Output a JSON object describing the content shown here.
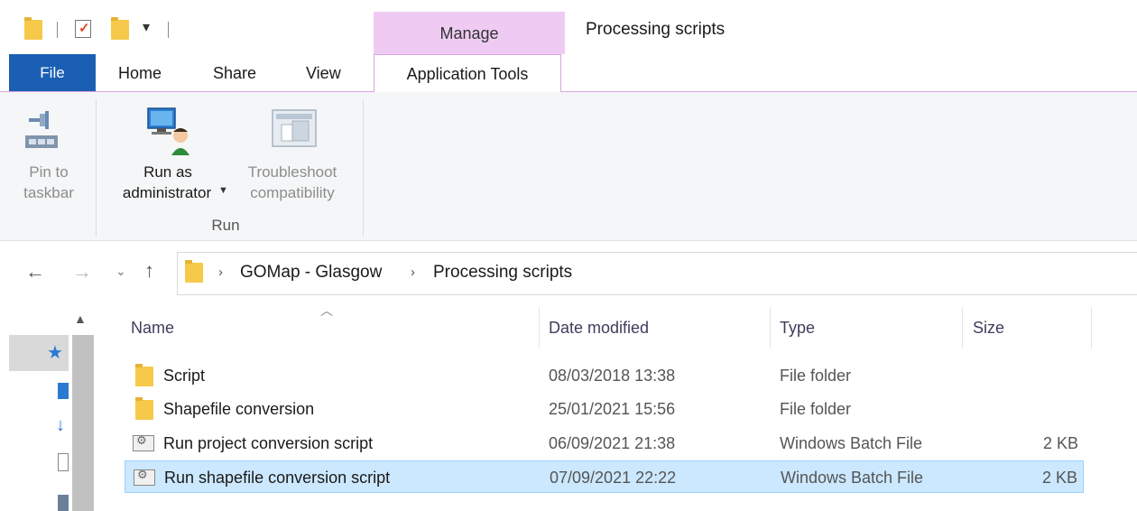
{
  "window": {
    "title": "Processing scripts"
  },
  "context_tab": {
    "label": "Manage"
  },
  "tabs": {
    "file": "File",
    "home": "Home",
    "share": "Share",
    "view": "View",
    "application_tools": "Application Tools"
  },
  "ribbon": {
    "pin": {
      "line1": "Pin to",
      "line2": "taskbar"
    },
    "run_admin": {
      "line1": "Run as",
      "line2": "administrator"
    },
    "troubleshoot": {
      "line1": "Troubleshoot",
      "line2": "compatibility"
    },
    "group_run": "Run"
  },
  "address": {
    "crumbs": [
      "GOMap - Glasgow",
      "Processing scripts"
    ]
  },
  "columns": {
    "name": "Name",
    "date": "Date modified",
    "type": "Type",
    "size": "Size"
  },
  "files": [
    {
      "name": "Script",
      "date": "08/03/2018 13:38",
      "type": "File folder",
      "size": "",
      "icon": "folder-icon"
    },
    {
      "name": "Shapefile conversion",
      "date": "25/01/2021 15:56",
      "type": "File folder",
      "size": "",
      "icon": "folder-icon"
    },
    {
      "name": "Run project conversion script",
      "date": "06/09/2021 21:38",
      "type": "Windows Batch File",
      "size": "2 KB",
      "icon": "batch-file-icon"
    },
    {
      "name": "Run shapefile conversion script",
      "date": "07/09/2021 22:22",
      "type": "Windows Batch File",
      "size": "2 KB",
      "icon": "batch-file-icon",
      "selected": true
    }
  ],
  "colors": {
    "accent": "#1a5fb4",
    "manage_tab": "#efcbf3",
    "selection": "#cce8ff"
  }
}
